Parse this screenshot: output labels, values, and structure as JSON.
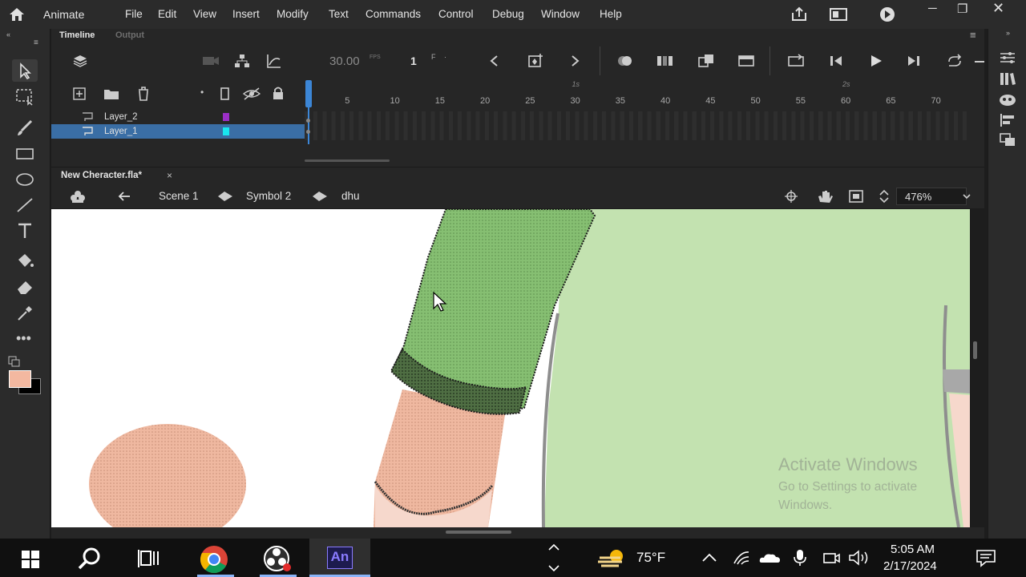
{
  "app": {
    "title": "Animate"
  },
  "menu": [
    "File",
    "Edit",
    "View",
    "Insert",
    "Modify",
    "Text",
    "Commands",
    "Control",
    "Debug",
    "Window",
    "Help"
  ],
  "panels": {
    "timeline_tab": "Timeline",
    "output_tab": "Output"
  },
  "timeline": {
    "fps": "30.00",
    "fps_unit": "FPS",
    "current_frame": "1",
    "frame_unit": "F",
    "layers": [
      {
        "name": "Layer_2",
        "color": "#9b2fc7"
      },
      {
        "name": "Layer_1",
        "color": "#19e6f0"
      }
    ],
    "ruler": [
      "5",
      "10",
      "15",
      "20",
      "25",
      "30",
      "35",
      "40",
      "45",
      "50",
      "55",
      "60",
      "65",
      "70"
    ],
    "ruler_seconds": [
      "1s",
      "2s"
    ]
  },
  "document": {
    "tab_title": "New Cheracter.fla*",
    "breadcrumbs": [
      "Scene 1",
      "Symbol 2",
      "dhu"
    ],
    "zoom": "476%"
  },
  "watermark": {
    "line1": "Activate Windows",
    "line2": "Go to Settings to activate",
    "line3": "Windows."
  },
  "colors": {
    "fill_swatch": "#f3b8a0",
    "stroke_swatch": "#000000",
    "accent": "#3a6ea5",
    "sleeve": "#7fb86a",
    "body": "#c3e2b0",
    "skin": "#eebfa8"
  },
  "taskbar": {
    "weather": "75°F",
    "time": "5:05 AM",
    "date": "2/17/2024",
    "animate_label": "An"
  }
}
